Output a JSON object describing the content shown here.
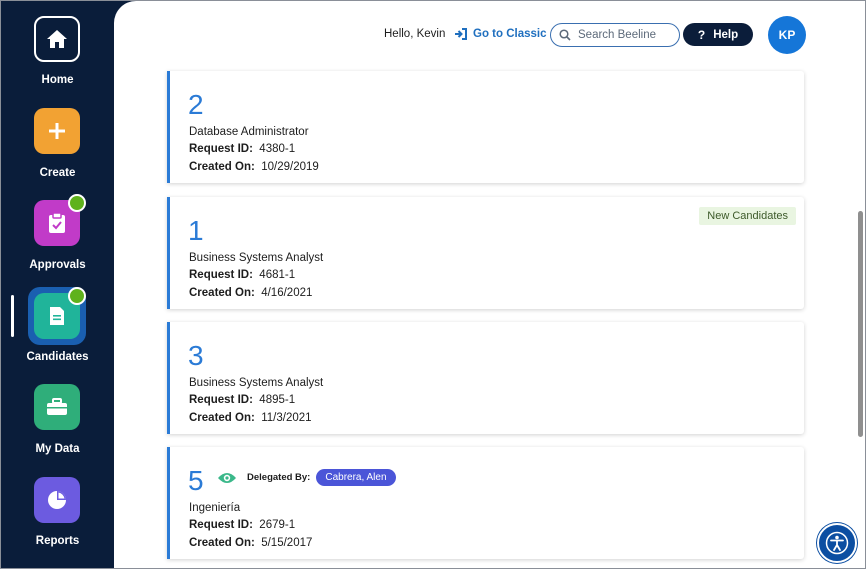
{
  "sidebar": {
    "items": [
      {
        "label": "Home",
        "icon": "home-icon",
        "color": "#0a1d3a"
      },
      {
        "label": "Create",
        "icon": "plus-icon",
        "color": "#f2a233"
      },
      {
        "label": "Approvals",
        "icon": "clipboard-check-icon",
        "color": "#c13bc8"
      },
      {
        "label": "Candidates",
        "icon": "document-icon",
        "color": "#20b49a"
      },
      {
        "label": "My Data",
        "icon": "briefcase-icon",
        "color": "#2fae7a"
      },
      {
        "label": "Reports",
        "icon": "pie-chart-icon",
        "color": "#6c5be0"
      }
    ],
    "active": "Candidates"
  },
  "header": {
    "greeting": "Hello, Kevin",
    "classic_link": "Go to Classic",
    "search_placeholder": "Search Beeline",
    "help_label": "Help",
    "avatar_initials": "KP"
  },
  "labels": {
    "request_id": "Request ID:",
    "created_on": "Created On:",
    "delegated_by": "Delegated By:"
  },
  "cards": [
    {
      "count": "2",
      "title": "Database Administrator",
      "request_id": "4380-1",
      "created_on": "10/29/2019"
    },
    {
      "count": "1",
      "title": "Business Systems Analyst",
      "request_id": "4681-1",
      "created_on": "4/16/2021",
      "tag": "New Candidates"
    },
    {
      "count": "3",
      "title": "Business Systems Analyst",
      "request_id": "4895-1",
      "created_on": "11/3/2021"
    },
    {
      "count": "5",
      "title": "Ingeniería",
      "request_id": "2679-1",
      "created_on": "5/15/2017",
      "delegated_by": "Cabrera, Alen"
    }
  ],
  "colors": {
    "accent": "#2b7bd6",
    "nav_bg": "#0a1d3a",
    "badge": "#5fb21c",
    "delegate_pill": "#4b55d8"
  }
}
